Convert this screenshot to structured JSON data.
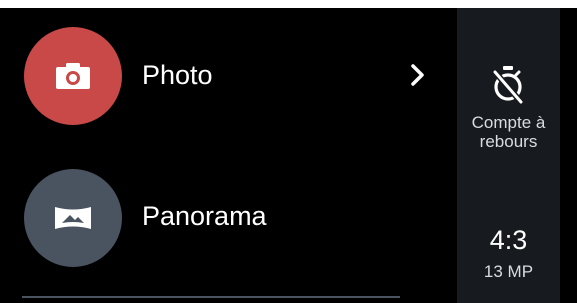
{
  "modes": {
    "photo": {
      "label": "Photo",
      "icon": "camera-icon",
      "color": "#c94949"
    },
    "panorama": {
      "label": "Panorama",
      "icon": "panorama-icon",
      "color": "#4a5360"
    }
  },
  "settings": {
    "timer": {
      "icon": "timer-off-icon",
      "label_line1": "Compte à",
      "label_line2": "rebours"
    },
    "aspect_ratio": {
      "value": "4:3",
      "megapixels": "13 MP"
    }
  },
  "colors": {
    "background": "#000000",
    "settings_strip": "#171a1e",
    "accent_red": "#c94949",
    "panorama_gray": "#4a5360"
  }
}
